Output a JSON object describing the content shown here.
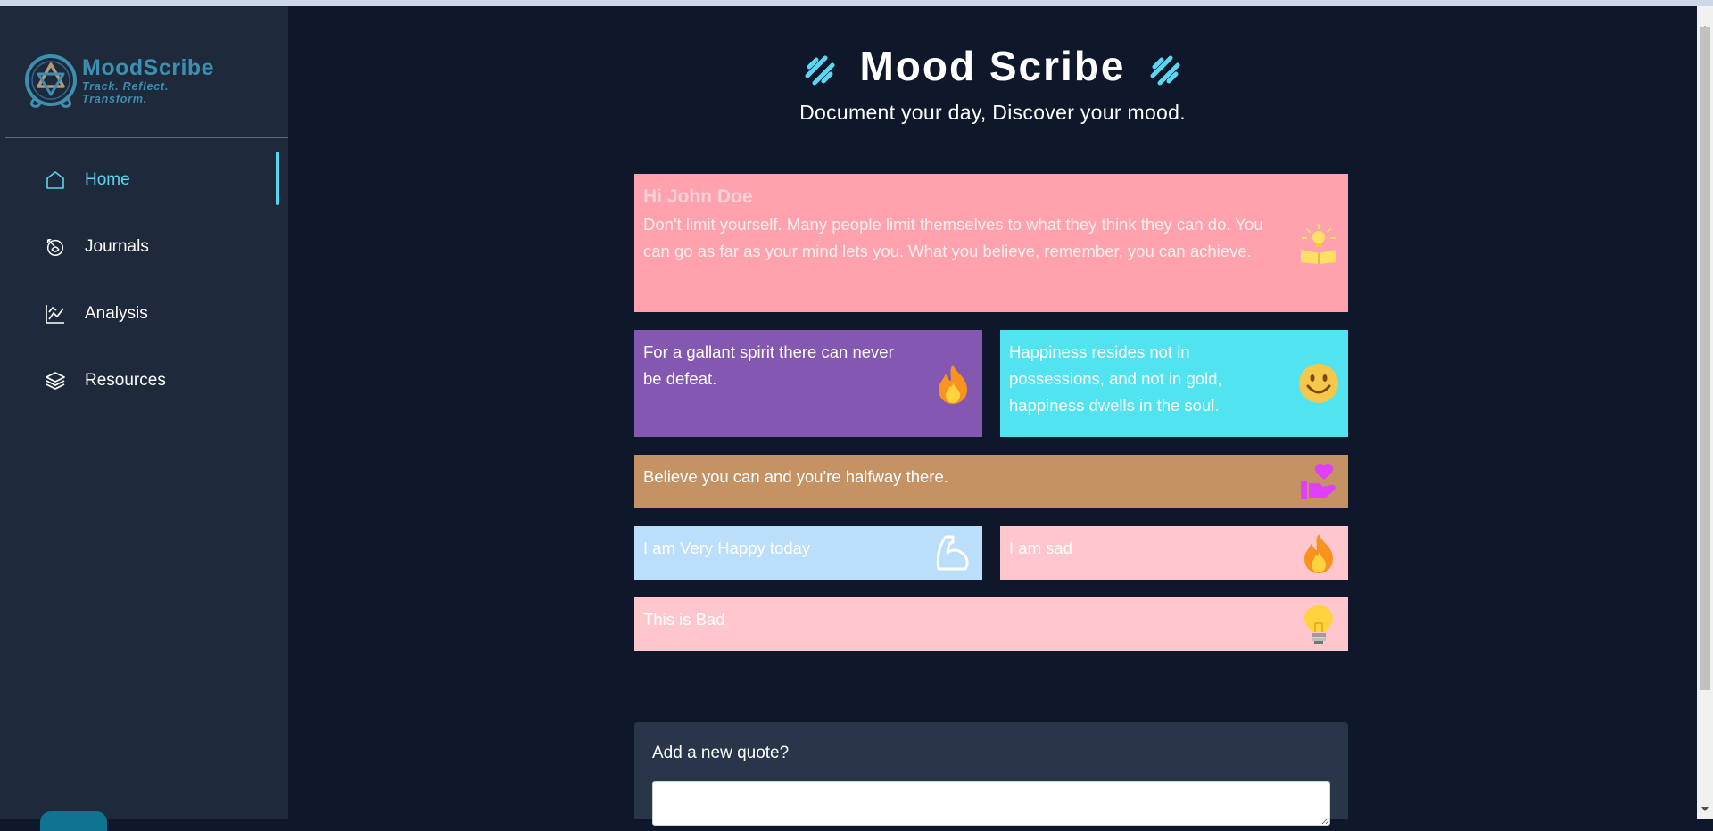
{
  "app": {
    "logo_name": "MoodScribe",
    "logo_tagline": "Track. Reflect. Transform."
  },
  "sidebar": {
    "items": [
      {
        "label": "Home",
        "icon": "home-icon",
        "active": true
      },
      {
        "label": "Journals",
        "icon": "journal-icon",
        "active": false
      },
      {
        "label": "Analysis",
        "icon": "chart-icon",
        "active": false
      },
      {
        "label": "Resources",
        "icon": "layers-icon",
        "active": false
      }
    ]
  },
  "header": {
    "title": "Mood Scribe",
    "subtitle": "Document your day, Discover your mood."
  },
  "greeting": {
    "name": "Hi John Doe",
    "quote": "Don't limit yourself. Many people limit themselves to what they think they can do. You can go as far as your mind lets you. What you believe, remember, you can achieve.",
    "icon": "book-lightbulb-icon",
    "color": "#ffa2ad"
  },
  "quotes": [
    {
      "text": "For a gallant spirit there can never be defeat.",
      "icon": "fire-icon",
      "color": "#8457b0"
    },
    {
      "text": "Happiness resides not in possessions, and not in gold, happiness dwells in the soul.",
      "icon": "smile-icon",
      "color": "#52e3f0"
    },
    {
      "text": "Believe you can and you're halfway there.",
      "icon": "heart-hand-icon",
      "color": "#c59264"
    },
    {
      "text": "I am Very Happy today",
      "icon": "flexed-arm-icon",
      "color": "#bbdffa"
    },
    {
      "text": "I am sad",
      "icon": "fire-icon",
      "color": "#ffc6cd"
    },
    {
      "text": "This is Bad",
      "icon": "lightbulb-icon",
      "color": "#ffc6cd"
    }
  ],
  "add_quote": {
    "label": "Add a new quote?",
    "placeholder": ""
  },
  "colors": {
    "background": "#0f172a",
    "sidebar": "#1e293b",
    "accent": "#5ad6f0"
  }
}
